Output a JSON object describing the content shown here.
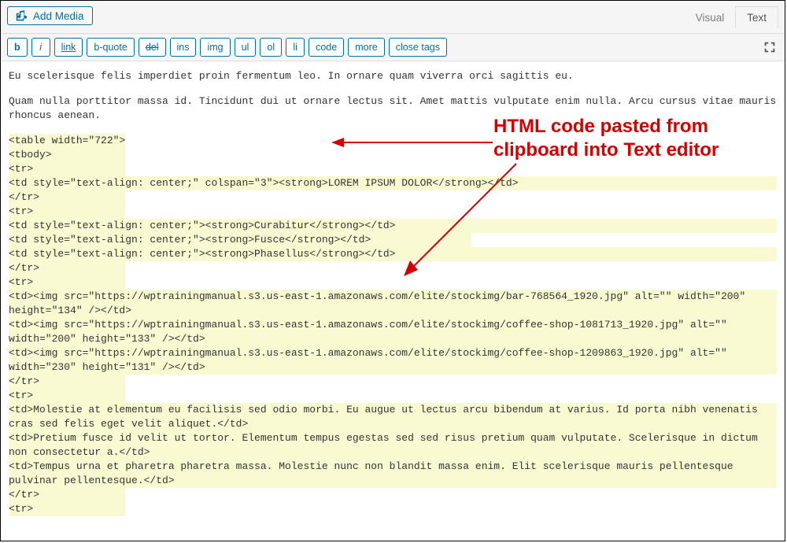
{
  "topbar": {
    "add_media_label": "Add Media"
  },
  "tabs": {
    "visual": "Visual",
    "text": "Text"
  },
  "quicktags": {
    "bold": "b",
    "italic": "i",
    "link": "link",
    "bquote": "b-quote",
    "del": "del",
    "ins": "ins",
    "img": "img",
    "ul": "ul",
    "ol": "ol",
    "li": "li",
    "code": "code",
    "more": "more",
    "close": "close tags"
  },
  "content": {
    "p1": "Eu scelerisque felis imperdiet proin fermentum leo. In ornare quam viverra orci sagittis eu.",
    "p2": "Quam nulla porttitor massa id. Tincidunt dui ut ornare lectus sit. Amet mattis vulputate enim nulla. Arcu cursus vitae mauris rhoncus aenean.",
    "code_lines": [
      "<table width=\"722\">",
      "<tbody>",
      "<tr>",
      "<td style=\"text-align: center;\" colspan=\"3\"><strong>LOREM IPSUM DOLOR</strong></td>",
      "</tr>",
      "<tr>",
      "<td style=\"text-align: center;\"><strong>Curabitur</strong></td>",
      "<td style=\"text-align: center;\"><strong>Fusce</strong></td>",
      "<td style=\"text-align: center;\"><strong>Phasellus</strong></td>",
      "</tr>",
      "<tr>",
      "<td><img src=\"https://wptrainingmanual.s3.us-east-1.amazonaws.com/elite/stockimg/bar-768564_1920.jpg\" alt=\"\" width=\"200\" height=\"134\" /></td>",
      "<td><img src=\"https://wptrainingmanual.s3.us-east-1.amazonaws.com/elite/stockimg/coffee-shop-1081713_1920.jpg\" alt=\"\" width=\"200\" height=\"133\" /></td>",
      "<td><img src=\"https://wptrainingmanual.s3.us-east-1.amazonaws.com/elite/stockimg/coffee-shop-1209863_1920.jpg\" alt=\"\" width=\"230\" height=\"131\" /></td>",
      "</tr>",
      "<tr>",
      "<td>Molestie at elementum eu facilisis sed odio morbi. Eu augue ut lectus arcu bibendum at varius. Id porta nibh venenatis cras sed felis eget velit aliquet.</td>",
      "<td>Pretium fusce id velit ut tortor. Elementum tempus egestas sed sed risus pretium quam vulputate. Scelerisque in dictum non consectetur a.</td>",
      "<td>Tempus urna et pharetra pharetra massa. Molestie nunc non blandit massa enim. Elit scelerisque mauris pellentesque pulvinar pellentesque.</td>",
      "</tr>",
      "<tr>"
    ]
  },
  "callout": {
    "line1": "HTML code pasted from",
    "line2": "clipboard into Text editor"
  }
}
